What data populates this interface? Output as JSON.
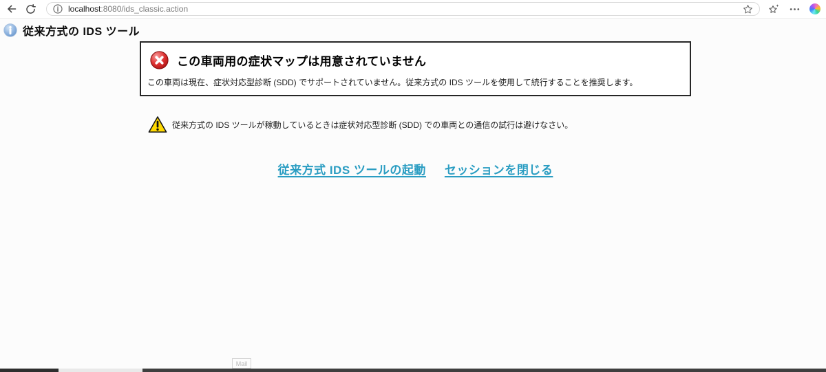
{
  "browser": {
    "url": {
      "host": "localhost",
      "rest": ":8080/ids_classic.action"
    }
  },
  "page": {
    "title": "従来方式の IDS ツール",
    "error_box": {
      "title": "この車両用の症状マップは用意されていません",
      "body": "この車両は現在、症状対応型診断 (SDD) でサポートされていません。従来方式の IDS ツールを使用して続行することを推奨します。"
    },
    "warning_text": "従来方式の IDS ツールが稼動しているときは症状対応型診断 (SDD) での車両との通信の試行は避けなさい。",
    "links": [
      {
        "label": "従来方式 IDS ツールの起動"
      },
      {
        "label": "セッションを閉じる"
      }
    ]
  },
  "taskbar": {
    "tooltip": "Mail"
  },
  "colors": {
    "link": "#2a9dc2",
    "error_red": "#c41414",
    "warning_yellow": "#ffd900",
    "info_blue": "#7aa7dc"
  }
}
